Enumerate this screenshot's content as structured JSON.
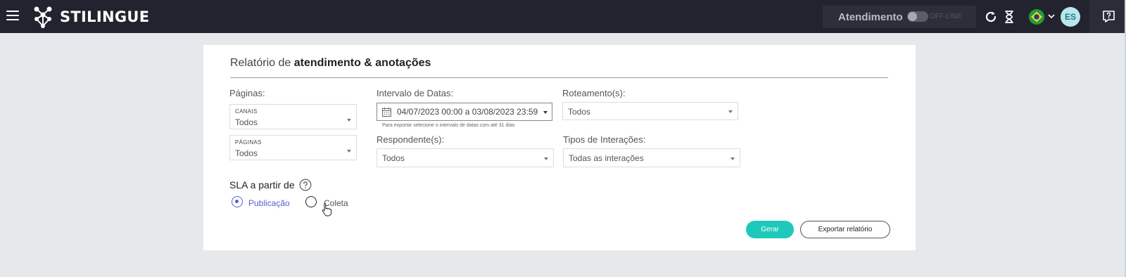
{
  "header": {
    "logo_text": "STILINGUE",
    "atendimento_label": "Atendimento",
    "status_text": "OFF-LINE",
    "avatar_initials": "ES"
  },
  "report": {
    "title_prefix": "Relatório de ",
    "title_bold": "atendimento & anotações",
    "paginas_label": "Páginas:",
    "canais_small": "CANAIS",
    "canais_value": "Todos",
    "paginas_small": "PÁGINAS",
    "paginas_value": "Todos",
    "intervalo_label": "Intervalo de Datas:",
    "date_range": "04/07/2023 00:00 a 03/08/2023 23:59",
    "date_hint": "Para exportar selecione o intervalo de datas com até 31 dias",
    "respondentes_label": "Respondente(s):",
    "respondentes_value": "Todos",
    "roteamento_label": "Roteamento(s):",
    "roteamento_value": "Todos",
    "tipos_label": "Tipos de Interações:",
    "tipos_value": "Todas as interações",
    "sla_label": "SLA a partir de",
    "sla_options": [
      "Publicação",
      "Coleta"
    ],
    "sla_selected": "Publicação",
    "gerar_label": "Gerar",
    "export_label": "Exportar relatório"
  },
  "colors": {
    "topbar": "#23232f",
    "accent": "#1ec9bb",
    "radio_selected": "#5b5bd6"
  }
}
